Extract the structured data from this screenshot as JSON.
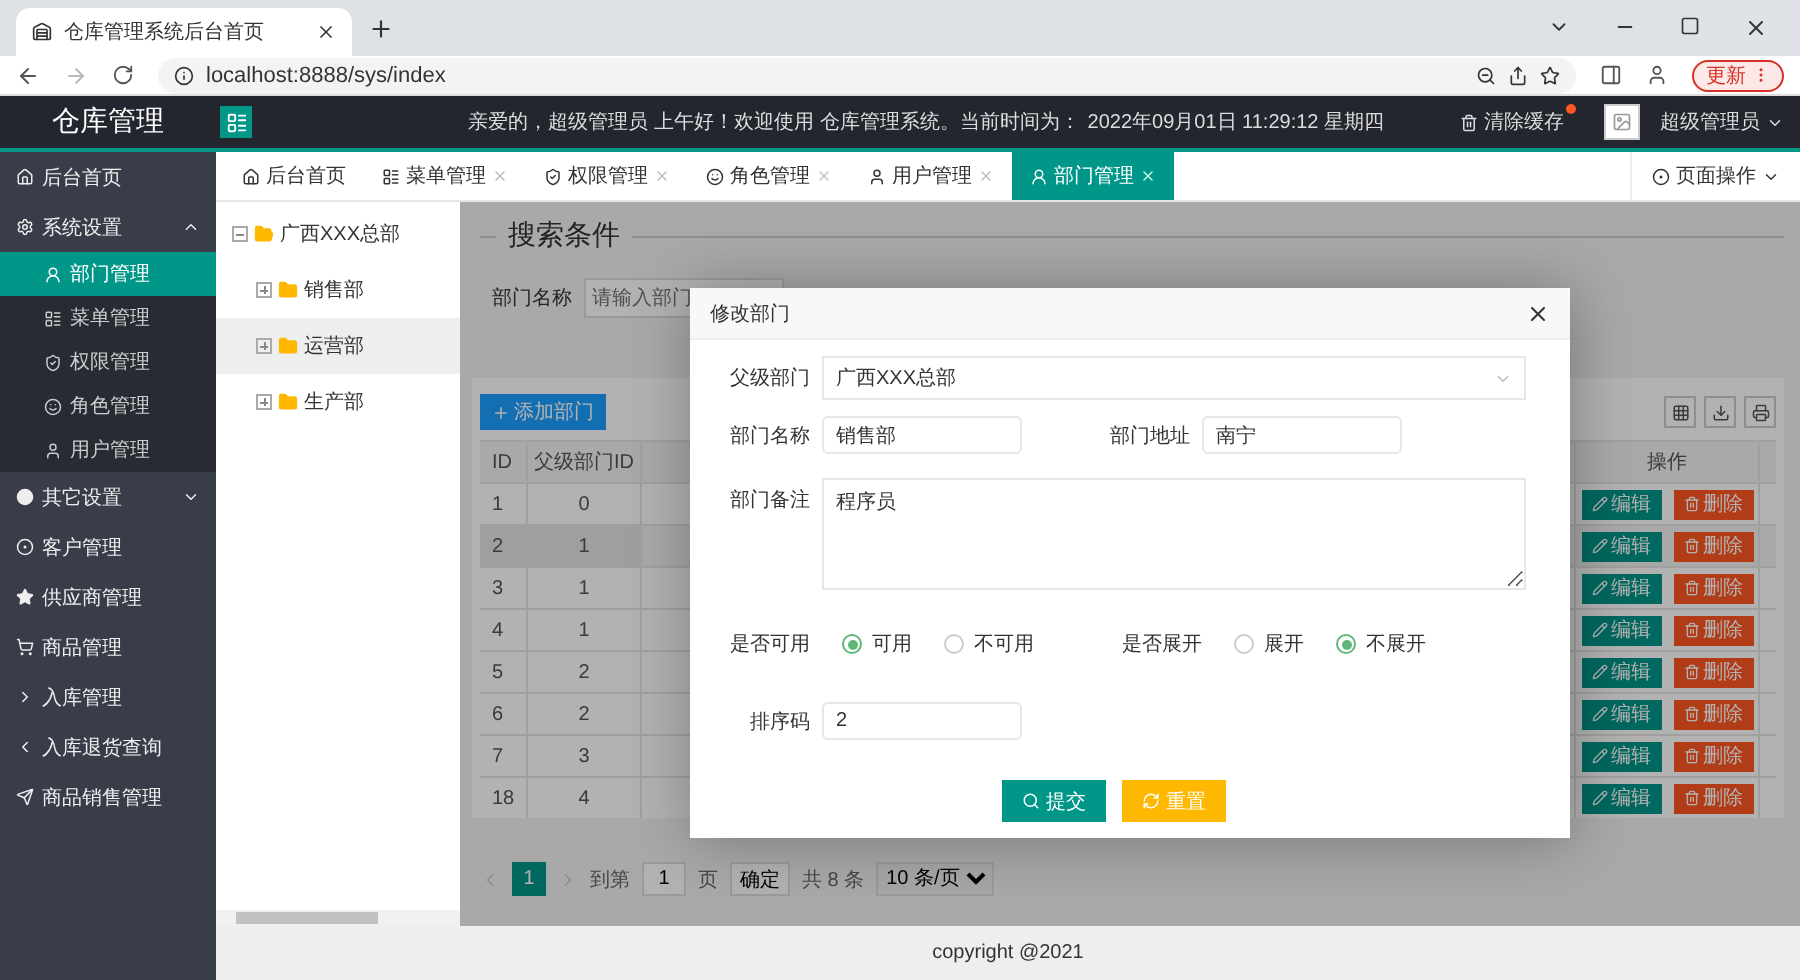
{
  "browser": {
    "tab_title": "仓库管理系统后台首页",
    "url": "localhost:8888/sys/index",
    "update_button": "更新"
  },
  "header": {
    "logo": "仓库管理",
    "greeting": "亲爱的，超级管理员 上午好！欢迎使用 仓库管理系统。当前时间为：",
    "time": "2022年09月01日 11:29:12  星期四",
    "clear_cache": "清除缓存",
    "clear_cache_dot": true,
    "user": "超级管理员"
  },
  "sidebar": {
    "items": [
      {
        "kind": "link",
        "label": "后台首页",
        "selected": false
      },
      {
        "kind": "group",
        "label": "系统设置",
        "selected": false,
        "expanded": true,
        "children": [
          {
            "label": "部门管理",
            "selected": true
          },
          {
            "label": "菜单管理",
            "selected": false
          },
          {
            "label": "权限管理",
            "selected": false
          },
          {
            "label": "角色管理",
            "selected": false
          },
          {
            "label": "用户管理",
            "selected": false
          }
        ]
      },
      {
        "kind": "group",
        "label": "其它设置",
        "selected": false,
        "expanded": false
      },
      {
        "kind": "link",
        "label": "客户管理",
        "selected": false
      },
      {
        "kind": "link",
        "label": "供应商管理",
        "selected": false
      },
      {
        "kind": "link",
        "label": "商品管理",
        "selected": false
      },
      {
        "kind": "link",
        "label": "入库管理",
        "selected": false
      },
      {
        "kind": "link",
        "label": "入库退货查询",
        "selected": false
      },
      {
        "kind": "link",
        "label": "商品销售管理",
        "selected": false
      }
    ]
  },
  "tabs": [
    {
      "label": "后台首页",
      "closable": false,
      "selected": false
    },
    {
      "label": "菜单管理",
      "closable": true,
      "selected": false
    },
    {
      "label": "权限管理",
      "closable": true,
      "selected": false
    },
    {
      "label": "角色管理",
      "closable": true,
      "selected": false
    },
    {
      "label": "用户管理",
      "closable": true,
      "selected": false
    },
    {
      "label": "部门管理",
      "closable": true,
      "selected": true
    }
  ],
  "page_actions": "页面操作",
  "tree": {
    "nodes": [
      {
        "label": "广西XXX总部",
        "expanded": true,
        "selected": false,
        "children": [
          {
            "label": "销售部",
            "expanded": false,
            "selected": false
          },
          {
            "label": "运营部",
            "expanded": false,
            "selected": true
          },
          {
            "label": "生产部",
            "expanded": false,
            "selected": false
          }
        ]
      }
    ]
  },
  "search": {
    "legend": "搜索条件",
    "fields": [
      {
        "label": "部门名称",
        "placeholder": "请输入部门"
      }
    ]
  },
  "toolbar": {
    "add_button": "添加部门"
  },
  "table": {
    "columns": [
      "ID",
      "父级部门ID",
      "操作"
    ],
    "rows": [
      {
        "id": "1",
        "parent_id": "0",
        "highlighted": false,
        "actions": [
          "编辑",
          "删除"
        ]
      },
      {
        "id": "2",
        "parent_id": "1",
        "highlighted": true,
        "actions": [
          "编辑",
          "删除"
        ]
      },
      {
        "id": "3",
        "parent_id": "1",
        "highlighted": false,
        "actions": [
          "编辑",
          "删除"
        ]
      },
      {
        "id": "4",
        "parent_id": "1",
        "highlighted": false,
        "actions": [
          "编辑",
          "删除"
        ]
      },
      {
        "id": "5",
        "parent_id": "2",
        "highlighted": false,
        "actions": [
          "编辑",
          "删除"
        ]
      },
      {
        "id": "6",
        "parent_id": "2",
        "highlighted": false,
        "actions": [
          "编辑",
          "删除"
        ]
      },
      {
        "id": "7",
        "parent_id": "3",
        "highlighted": false,
        "actions": [
          "编辑",
          "删除"
        ]
      },
      {
        "id": "18",
        "parent_id": "4",
        "highlighted": false,
        "actions": [
          "编辑",
          "删除"
        ]
      }
    ]
  },
  "pagination": {
    "pages": [
      {
        "label": "1",
        "selected": true
      }
    ],
    "goto_label": "到第",
    "goto_value": "1",
    "page_unit": "页",
    "confirm": "确定",
    "total": "共 8 条",
    "page_size": "10 条/页"
  },
  "footer": "copyright @2021",
  "modal": {
    "title": "修改部门",
    "parent": {
      "label": "父级部门",
      "value": "广西XXX总部"
    },
    "name": {
      "label": "部门名称",
      "value": "销售部"
    },
    "address": {
      "label": "部门地址",
      "value": "南宁"
    },
    "remark": {
      "label": "部门备注",
      "value": "程序员"
    },
    "radio_groups": [
      {
        "label": "是否可用",
        "options": [
          {
            "label": "可用",
            "selected": true
          },
          {
            "label": "不可用",
            "selected": false
          }
        ]
      },
      {
        "label": "是否展开",
        "options": [
          {
            "label": "展开",
            "selected": false
          },
          {
            "label": "不展开",
            "selected": true
          }
        ]
      }
    ],
    "sort": {
      "label": "排序码",
      "value": "2"
    },
    "buttons": [
      {
        "kind": "submit",
        "label": "提交"
      },
      {
        "kind": "reset",
        "label": "重置"
      }
    ]
  }
}
